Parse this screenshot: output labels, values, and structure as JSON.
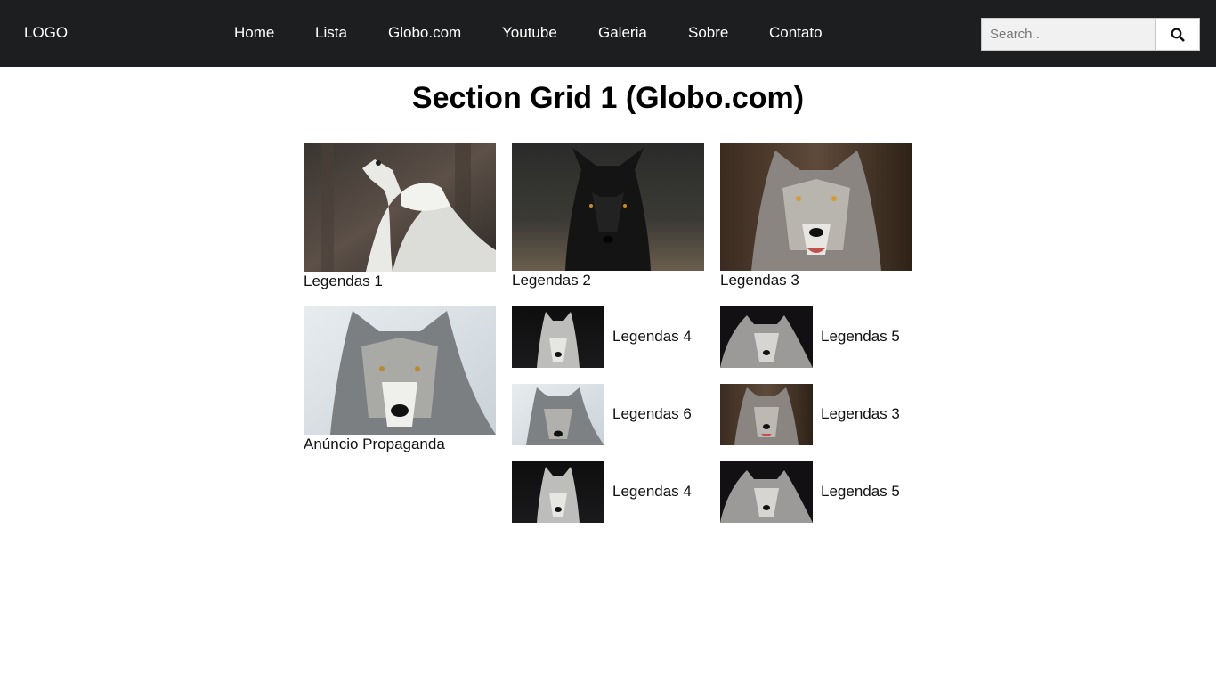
{
  "header": {
    "logo": "LOGO",
    "nav": [
      "Home",
      "Lista",
      "Globo.com",
      "Youtube",
      "Galeria",
      "Sobre",
      "Contato"
    ],
    "search": {
      "placeholder": "Search..",
      "value": "",
      "button_icon": "search-icon"
    }
  },
  "main": {
    "title": "Section Grid 1 (Globo.com)",
    "large_cards": [
      {
        "caption": "Legendas 1",
        "image": "white-wolf-howling"
      },
      {
        "caption": "Legendas 2",
        "image": "black-wolf"
      },
      {
        "caption": "Legendas 3",
        "image": "grey-wolf-snarling"
      },
      {
        "caption": "Anúncio Propaganda",
        "image": "grey-wolf-snow"
      }
    ],
    "small_cards": [
      {
        "caption": "Legendas 4",
        "image": "white-wolf-dark-background"
      },
      {
        "caption": "Legendas 5",
        "image": "white-wolf-black-background"
      },
      {
        "caption": "Legendas 6",
        "image": "grey-wolf-snow"
      },
      {
        "caption": "Legendas 3",
        "image": "grey-wolf-snarling"
      },
      {
        "caption": "Legendas 4",
        "image": "white-wolf-dark-background"
      },
      {
        "caption": "Legendas 5",
        "image": "white-wolf-black-background"
      }
    ]
  },
  "colors": {
    "header_bg": "#1d1e20",
    "header_text": "#ffffff",
    "page_bg": "#ffffff"
  }
}
